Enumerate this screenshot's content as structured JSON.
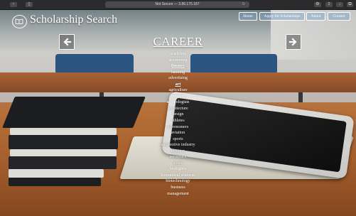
{
  "browser": {
    "address": "Not Secure — 3.86.175.187",
    "reload_icon": "reload-icon"
  },
  "site": {
    "title": "Scholarship Search",
    "logo_icon": "book-icon",
    "nav": [
      {
        "label": "Home"
      },
      {
        "label": "Apply for Scholarships"
      },
      {
        "label": "About"
      },
      {
        "label": "Contact"
      }
    ]
  },
  "career": {
    "heading": "CAREER",
    "prev_icon": "arrow-left-icon",
    "next_icon": "arrow-right-icon",
    "active": "finance",
    "items": [
      "academia",
      "accounting",
      "finance",
      "banking",
      "advertising",
      "art",
      "agriculture",
      "farming",
      "archeologists",
      "architecture",
      "design",
      "athletes",
      "astronomers",
      "aviation",
      "sports",
      "automotive industry",
      "aviation",
      "aerospace",
      "space",
      "biologists",
      "biomedical sciences",
      "biotechnology",
      "business",
      "management"
    ]
  },
  "colors": {
    "nav_button_bg": "#78a0c8",
    "text": "#ffffff"
  }
}
